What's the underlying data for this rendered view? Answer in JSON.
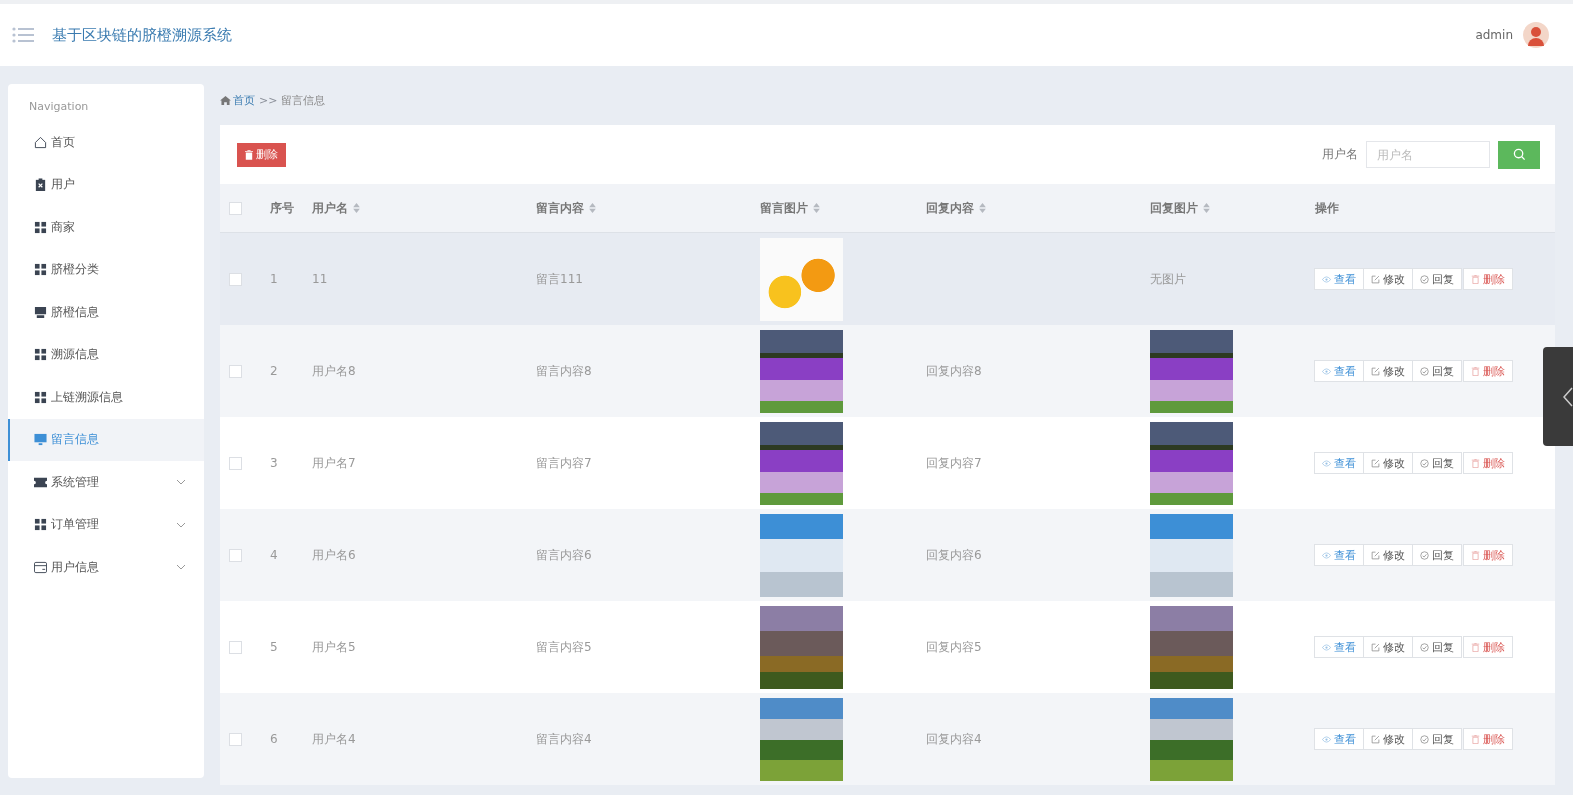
{
  "header": {
    "title": "基于区块链的脐橙溯源系统",
    "user": "admin"
  },
  "sidebar": {
    "heading": "Navigation",
    "items": [
      {
        "label": "首页",
        "selected": false,
        "expandable": false
      },
      {
        "label": "用户",
        "selected": false,
        "expandable": false
      },
      {
        "label": "商家",
        "selected": false,
        "expandable": false
      },
      {
        "label": "脐橙分类",
        "selected": false,
        "expandable": false
      },
      {
        "label": "脐橙信息",
        "selected": false,
        "expandable": false
      },
      {
        "label": "溯源信息",
        "selected": false,
        "expandable": false
      },
      {
        "label": "上链溯源信息",
        "selected": false,
        "expandable": false
      },
      {
        "label": "留言信息",
        "selected": true,
        "expandable": false
      },
      {
        "label": "系统管理",
        "selected": false,
        "expandable": true
      },
      {
        "label": "订单管理",
        "selected": false,
        "expandable": true
      },
      {
        "label": "用户信息",
        "selected": false,
        "expandable": true
      }
    ]
  },
  "breadcrumb": {
    "home": "首页",
    "separator": ">>",
    "current": "留言信息"
  },
  "toolbar": {
    "delete_button": "删除",
    "search_label": "用户名",
    "search_placeholder": "用户名"
  },
  "table": {
    "select_all_checked": false,
    "columns": [
      {
        "label": "序号",
        "sortable": false
      },
      {
        "label": "用户名",
        "sortable": true
      },
      {
        "label": "留言内容",
        "sortable": true
      },
      {
        "label": "留言图片",
        "sortable": true
      },
      {
        "label": "回复内容",
        "sortable": true
      },
      {
        "label": "回复图片",
        "sortable": true
      },
      {
        "label": "操作",
        "sortable": false
      }
    ],
    "rows": [
      {
        "checked": false,
        "hovered": true,
        "index": "1",
        "username": "11",
        "content": "留言111",
        "reply_image_text": "无图片",
        "actions": [
          "查看",
          "修改",
          "回复",
          "删除"
        ]
      },
      {
        "checked": false,
        "hovered": false,
        "index": "2",
        "username": "用户名8",
        "content": "留言内容8",
        "reply": "回复内容8",
        "actions": [
          "查看",
          "修改",
          "回复",
          "删除"
        ]
      },
      {
        "checked": false,
        "hovered": false,
        "index": "3",
        "username": "用户名7",
        "content": "留言内容7",
        "reply": "回复内容7",
        "actions": [
          "查看",
          "修改",
          "回复",
          "删除"
        ]
      },
      {
        "checked": false,
        "hovered": false,
        "index": "4",
        "username": "用户名6",
        "content": "留言内容6",
        "reply": "回复内容6",
        "actions": [
          "查看",
          "修改",
          "回复",
          "删除"
        ]
      },
      {
        "checked": false,
        "hovered": false,
        "index": "5",
        "username": "用户名5",
        "content": "留言内容5",
        "reply": "回复内容5",
        "actions": [
          "查看",
          "修改",
          "回复",
          "删除"
        ]
      },
      {
        "checked": false,
        "hovered": false,
        "index": "6",
        "username": "用户名4",
        "content": "留言内容4",
        "reply": "回复内容4",
        "actions": [
          "查看",
          "修改",
          "回复",
          "删除"
        ]
      }
    ]
  }
}
